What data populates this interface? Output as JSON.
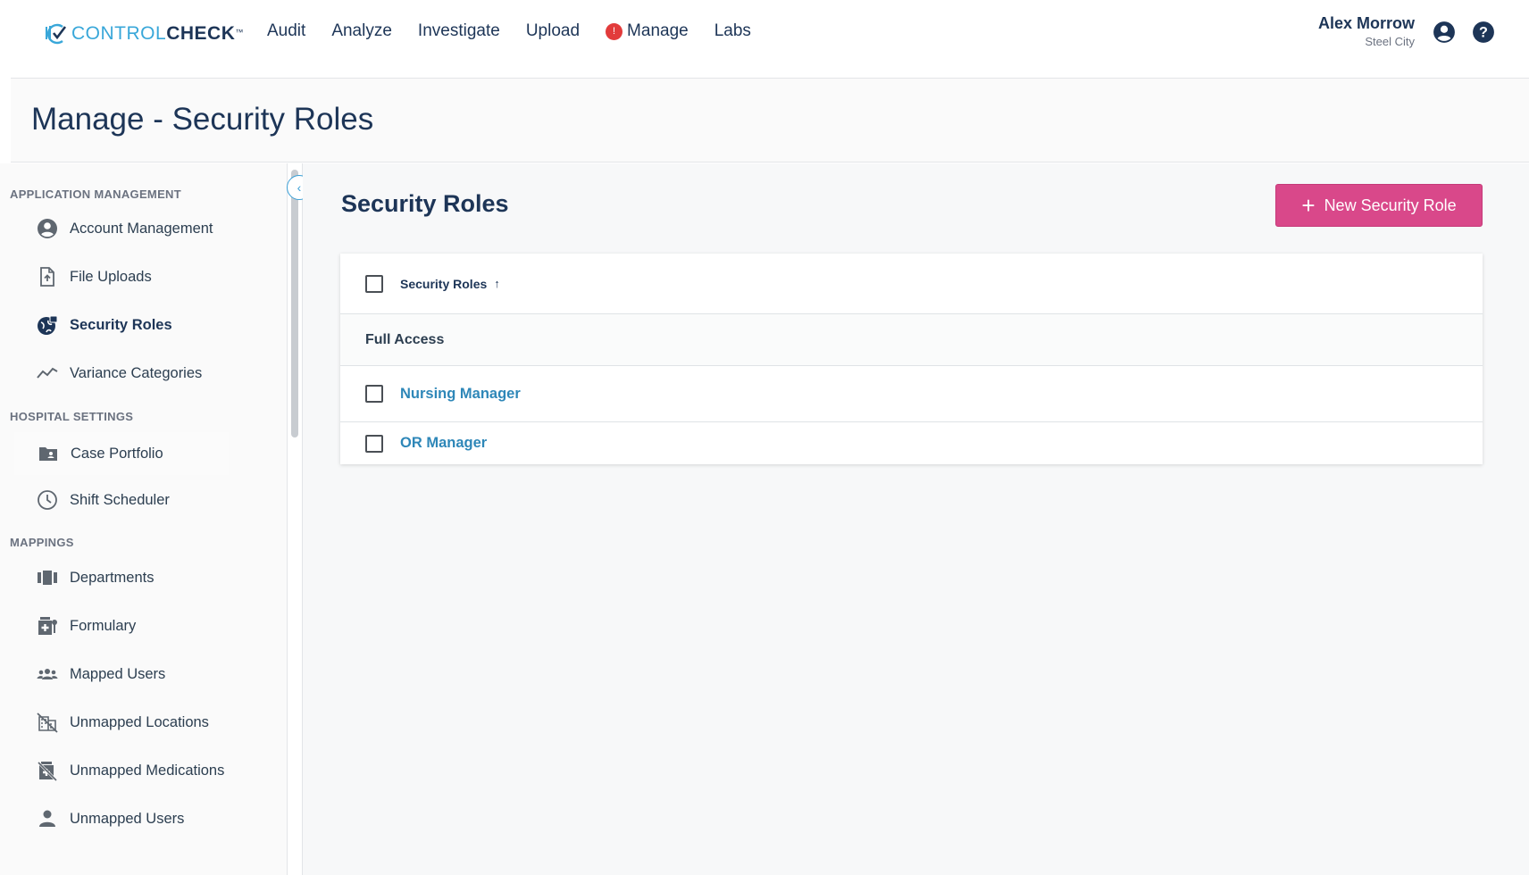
{
  "brand": {
    "part1": "CONTROL",
    "part2": "CHECK",
    "tm": "™"
  },
  "nav": {
    "links": [
      "Audit",
      "Analyze",
      "Investigate",
      "Upload",
      "Manage",
      "Labs"
    ],
    "manage_badge": "!"
  },
  "user": {
    "name": "Alex Morrow",
    "org": "Steel City"
  },
  "page": {
    "title": "Manage - Security Roles"
  },
  "sidebar": {
    "sections": [
      {
        "title": "APPLICATION MANAGEMENT",
        "items": [
          {
            "label": "Account Management",
            "icon": "account-circle-icon"
          },
          {
            "label": "File Uploads",
            "icon": "file-upload-icon"
          },
          {
            "label": "Security Roles",
            "icon": "security-globe-icon",
            "active": true
          },
          {
            "label": "Variance Categories",
            "icon": "trend-line-icon"
          }
        ]
      },
      {
        "title": "HOSPITAL SETTINGS",
        "items": [
          {
            "label": "Case Portfolio",
            "icon": "folder-person-icon"
          },
          {
            "label": "Shift Scheduler",
            "icon": "clock-icon"
          }
        ]
      },
      {
        "title": "MAPPINGS",
        "items": [
          {
            "label": "Departments",
            "icon": "departments-icon"
          },
          {
            "label": "Formulary",
            "icon": "formulary-icon"
          },
          {
            "label": "Mapped Users",
            "icon": "group-icon"
          },
          {
            "label": "Unmapped Locations",
            "icon": "building-off-icon"
          },
          {
            "label": "Unmapped Medications",
            "icon": "medication-off-icon"
          },
          {
            "label": "Unmapped Users",
            "icon": "person-icon"
          }
        ]
      }
    ]
  },
  "main": {
    "title": "Security Roles",
    "new_button": "New Security Role",
    "table": {
      "column_header": "Security Roles",
      "sort": "ascending",
      "group": "Full Access",
      "rows": [
        "Nursing Manager",
        "OR Manager"
      ]
    }
  },
  "colors": {
    "accent": "#d9488a",
    "link": "#2e87b8",
    "brand_blue": "#39a7d9",
    "navy": "#1d3557"
  }
}
